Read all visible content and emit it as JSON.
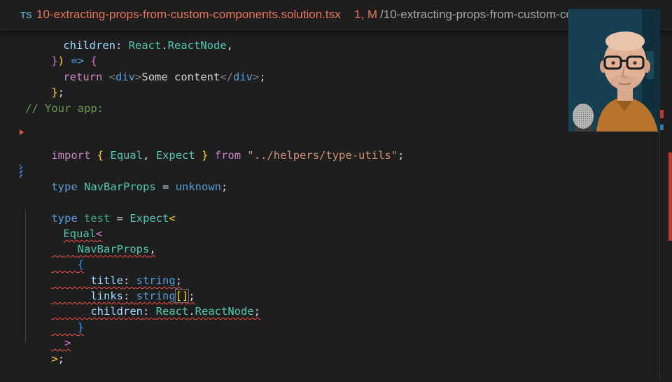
{
  "tab": {
    "language_badge": "TS",
    "filename": "10-extracting-props-from-custom-components.solution.tsx",
    "status": "1, M",
    "breadcrumb": "/10-extracting-props-from-custom-co"
  },
  "code": {
    "l1_prop": "children",
    "l1_react": "React",
    "l1_node": "ReactNode",
    "l2_arrow": "=>",
    "l3_return": "return",
    "l3_tag": "div",
    "l3_text": "Some content",
    "l3_closetag": "div",
    "comment": "// Your app:",
    "import_kw": "import",
    "import_equal": "Equal",
    "import_expect": "Expect",
    "import_from": "from",
    "import_path": "\"../helpers/type-utils\"",
    "type_kw": "type",
    "navbar_props": "NavBarProps",
    "unknown_kw": "unknown",
    "test_name": "test",
    "expect_fn": "Expect",
    "equal_fn": "Equal",
    "title_prop": "title",
    "links_prop": "links",
    "children_prop": "children",
    "string_kw": "string",
    "react_ns": "React",
    "reactnode_ty": "ReactNode"
  },
  "colors": {
    "error": "#f14c4c",
    "modified": "#e8755a"
  },
  "webcam": {
    "description_icon": "presenter-webcam-icon"
  }
}
